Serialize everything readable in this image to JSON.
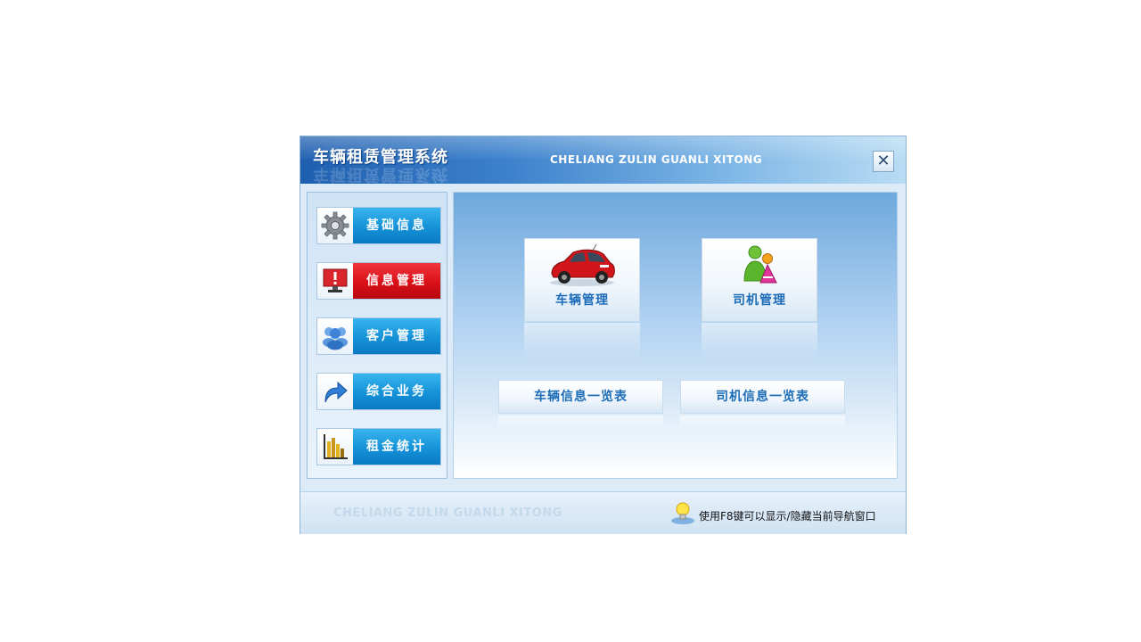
{
  "window": {
    "title_cn": "车辆租赁管理系统",
    "title_en": "CHELIANG ZULIN GUANLI XITONG",
    "close_label": "✕"
  },
  "sidebar": {
    "items": [
      {
        "label": "基础信息",
        "icon": "gear-icon"
      },
      {
        "label": "信息管理",
        "icon": "computer-alert-icon",
        "active": true
      },
      {
        "label": "客户管理",
        "icon": "users-icon"
      },
      {
        "label": "综合业务",
        "icon": "arrow-icon"
      },
      {
        "label": "租金统计",
        "icon": "bar-chart-icon"
      }
    ]
  },
  "main": {
    "tiles": [
      {
        "label": "车辆管理",
        "icon": "car-icon"
      },
      {
        "label": "司机管理",
        "icon": "driver-icon"
      }
    ],
    "list_buttons": [
      {
        "label": "车辆信息一览表"
      },
      {
        "label": "司机信息一览表"
      }
    ]
  },
  "footer": {
    "watermark": "CHELIANG ZULIN GUANLI XITONG",
    "tip": "使用F8键可以显示/隐藏当前导航窗口",
    "tip_icon": "lightbulb-icon"
  },
  "colors": {
    "title_bar": "#2f73c2",
    "side_button_blue": "#1592d8",
    "side_button_active_red": "#da1018",
    "tile_text": "#1c6cb8"
  }
}
